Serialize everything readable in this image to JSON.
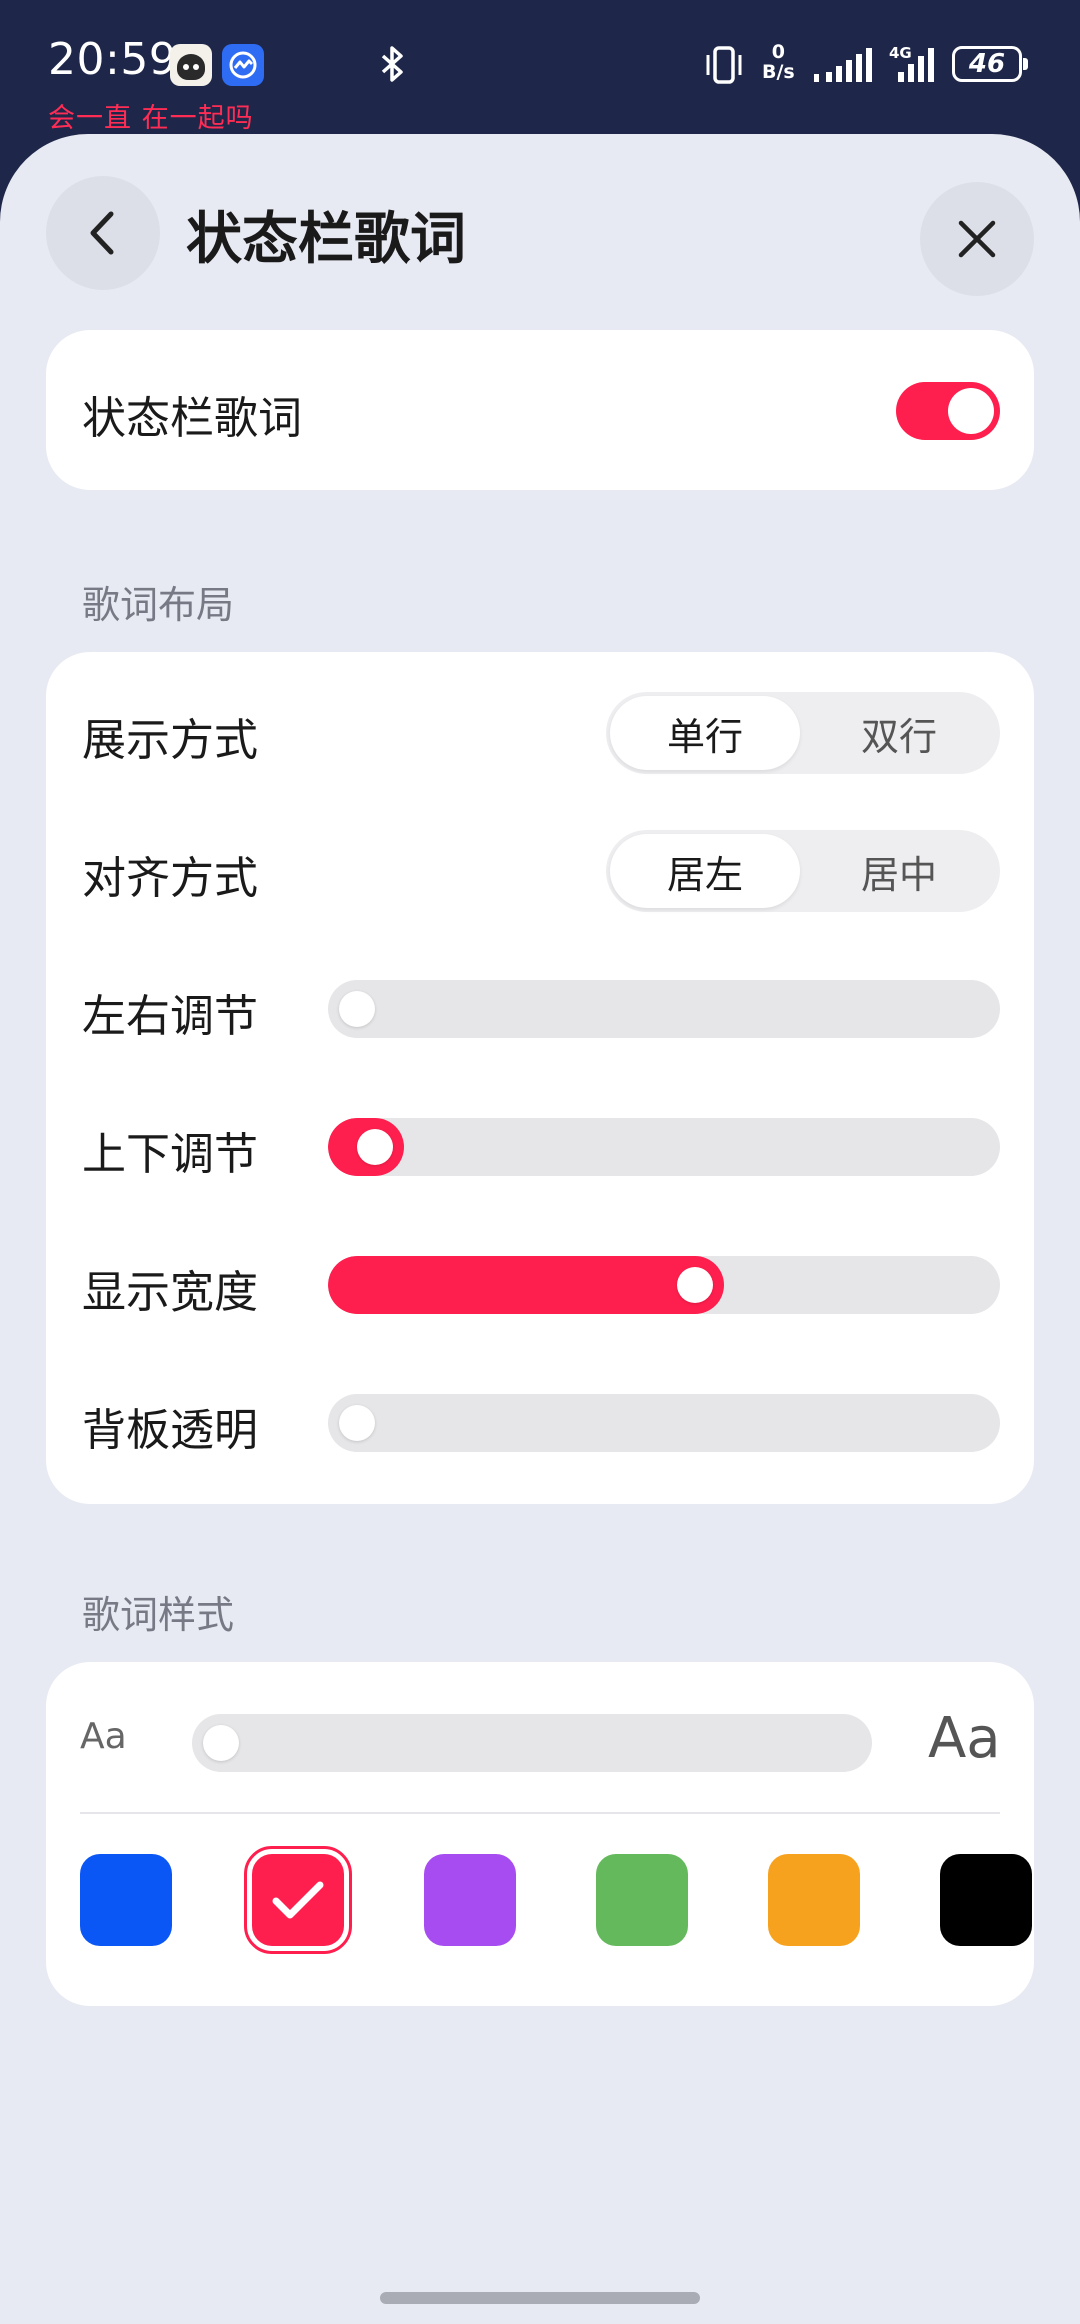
{
  "status_bar": {
    "time": "20:59",
    "lyric": "会一直 在一起吗",
    "net_speed_value": "0",
    "net_speed_unit": "B/s",
    "network_type": "4G",
    "battery": "46"
  },
  "header": {
    "title": "状态栏歌词"
  },
  "main_toggle": {
    "label": "状态栏歌词",
    "on": true
  },
  "layout_section": {
    "heading": "歌词布局",
    "display_mode": {
      "label": "展示方式",
      "options": [
        "单行",
        "双行"
      ],
      "selected": "单行"
    },
    "alignment": {
      "label": "对齐方式",
      "options": [
        "居左",
        "居中"
      ],
      "selected": "居左"
    },
    "horizontal": {
      "label": "左右调节",
      "value": 0.0
    },
    "vertical": {
      "label": "上下调节",
      "value": 0.03
    },
    "width": {
      "label": "显示宽度",
      "value": 0.55
    },
    "bg_opacity": {
      "label": "背板透明",
      "value": 0.0
    }
  },
  "style_section": {
    "heading": "歌词样式",
    "font_small_label": "Aa",
    "font_large_label": "Aa",
    "font_size": 0.0,
    "colors": [
      "#0b57f5",
      "#ff1f4e",
      "#a64cf0",
      "#63b95b",
      "#f7a21f",
      "#000000"
    ],
    "selected_color": "#ff1f4e"
  },
  "colors": {
    "accent": "#ff1f4e",
    "sheet_bg": "#e8eaf3",
    "status_bar_bg": "#1e2749"
  }
}
